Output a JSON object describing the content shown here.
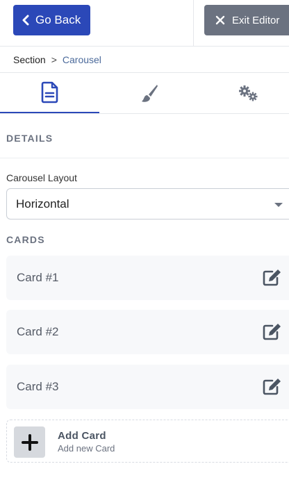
{
  "header": {
    "back_label": "Go Back",
    "exit_label": "Exit Editor"
  },
  "breadcrumb": {
    "parent": "Section",
    "separator": ">",
    "current": "Carousel"
  },
  "tabs": [
    {
      "name": "content",
      "icon": "document-icon",
      "active": true
    },
    {
      "name": "style",
      "icon": "brush-icon",
      "active": false
    },
    {
      "name": "settings",
      "icon": "gears-icon",
      "active": false
    }
  ],
  "details": {
    "title": "DETAILS",
    "layout_label": "Carousel Layout",
    "layout_value": "Horizontal"
  },
  "cards": {
    "title": "CARDS",
    "items": [
      {
        "label": "Card #1"
      },
      {
        "label": "Card #2"
      },
      {
        "label": "Card #3"
      }
    ],
    "add": {
      "title": "Add Card",
      "subtitle": "Add new Card"
    }
  },
  "colors": {
    "primary": "#2b48b8",
    "secondary": "#6b7280"
  }
}
